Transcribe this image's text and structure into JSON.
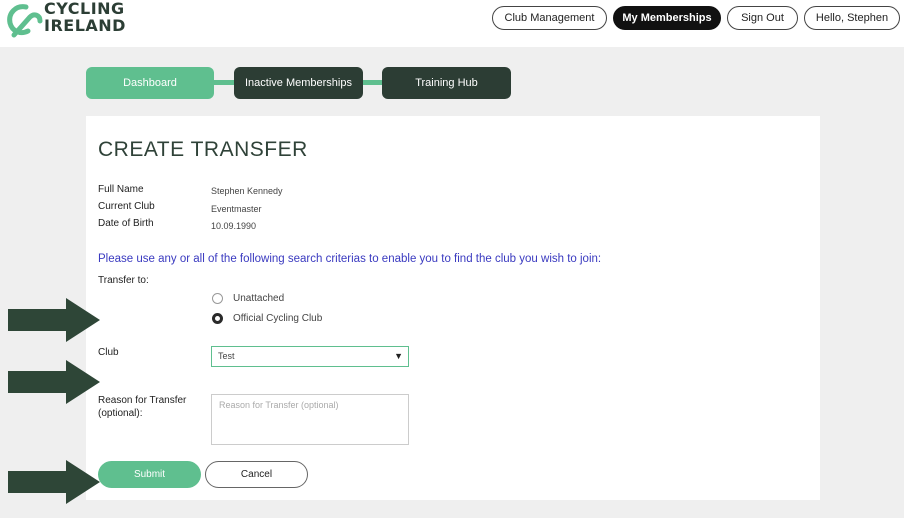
{
  "header": {
    "logo": {
      "line1": "CYCLING",
      "line2": "IRELAND"
    },
    "nav": {
      "club_management": "Club Management",
      "my_memberships": "My Memberships",
      "sign_out": "Sign Out",
      "hello": "Hello, Stephen"
    }
  },
  "tabs": [
    {
      "label": "Dashboard",
      "state": "active"
    },
    {
      "label": "Inactive Memberships",
      "state": "inactive"
    },
    {
      "label": "Training Hub",
      "state": "inactive"
    }
  ],
  "form": {
    "title": "CREATE TRANSFER",
    "full_name_label": "Full Name",
    "full_name": "Stephen Kennedy",
    "current_club_label": "Current Club",
    "current_club": "Eventmaster",
    "dob_label": "Date of Birth",
    "dob": "10.09.1990",
    "instructions": "Please use any or all of the following search criterias to enable you to find the club you wish to join:",
    "transfer_to_label": "Transfer to:",
    "options": [
      {
        "label": "Unattached",
        "checked": false
      },
      {
        "label": "Official Cycling Club",
        "checked": true
      }
    ],
    "club_label": "Club",
    "club_selected": "Test",
    "reason_label_1": "Reason for Transfer",
    "reason_label_2": "(optional):",
    "reason_placeholder": "Reason for Transfer (optional)",
    "submit": "Submit",
    "cancel": "Cancel"
  },
  "colors": {
    "accent": "#5fbf8f",
    "dark": "#2c3d34",
    "arrow": "#2e4637",
    "instructions": "#3a3ac0"
  }
}
